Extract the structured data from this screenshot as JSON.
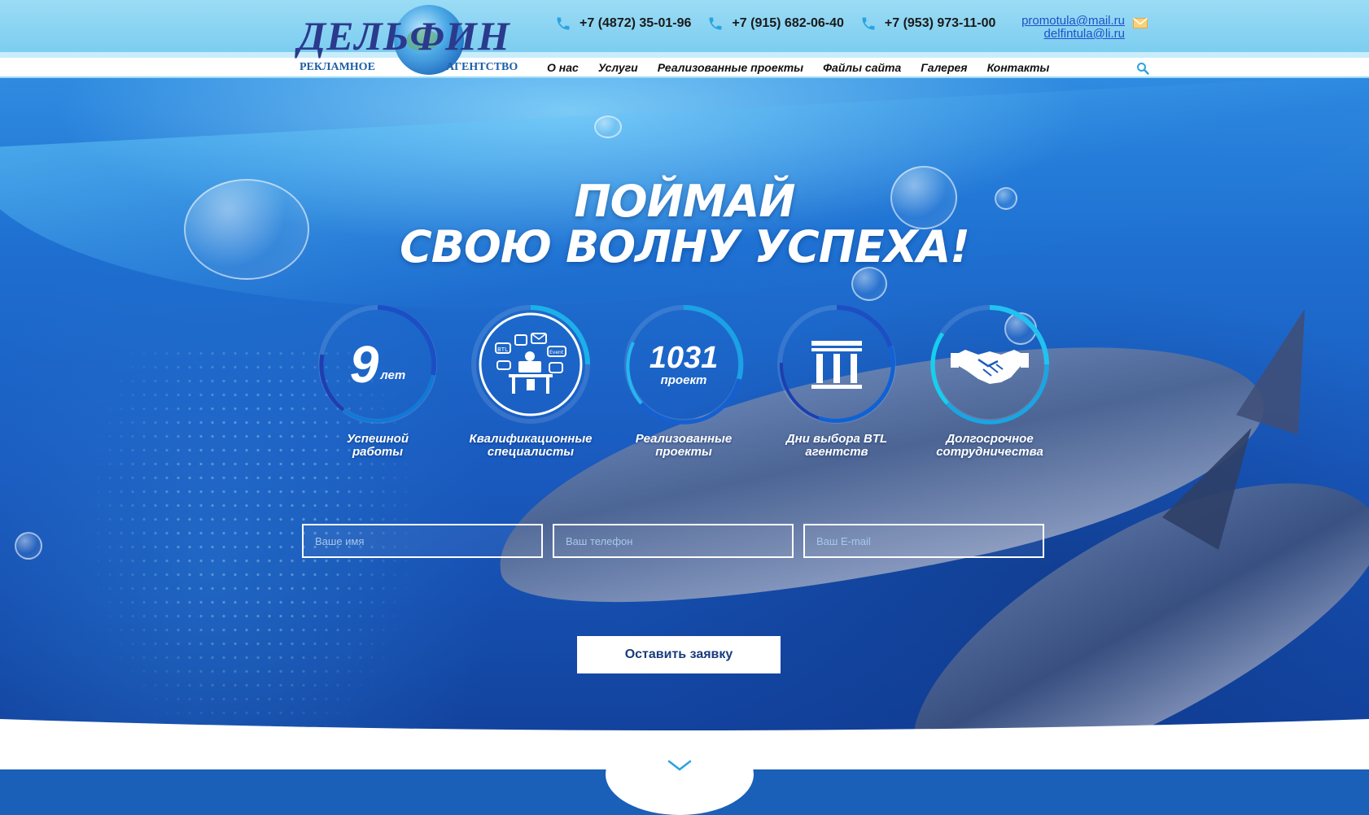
{
  "brand": {
    "logo_text": "ДЕЛЬФИН",
    "logo_sub_left": "РЕКЛАМНОЕ",
    "logo_sub_right": "АГЕНТСТВО"
  },
  "contacts": {
    "phones": [
      "+7 (4872) 35-01-96",
      "+7 (915) 682-06-40",
      "+7 (953) 973-11-00"
    ],
    "emails": [
      "promotula@mail.ru",
      "delfintula@li.ru"
    ]
  },
  "nav": {
    "items": [
      "О нас",
      "Услуги",
      "Реализованные проекты",
      "Файлы сайта",
      "Галерея",
      "Контакты"
    ]
  },
  "hero": {
    "headline_line1": "ПОЙМАЙ",
    "headline_line2": "СВОЮ ВОЛНУ УСПЕХА!"
  },
  "stats": [
    {
      "value": "9",
      "unit": "лет",
      "label_line1": "Успешной",
      "label_line2": "работы",
      "icon": "number"
    },
    {
      "value": "",
      "unit": "",
      "label_line1": "Квалификационные",
      "label_line2": "специалисты",
      "icon": "specialist-desk-icon"
    },
    {
      "value": "1031",
      "unit": "проект",
      "label_line1": "Реализованные",
      "label_line2": "проекты",
      "icon": "number"
    },
    {
      "value": "",
      "unit": "",
      "label_line1": "Дни выбора BTL",
      "label_line2": "агентств",
      "icon": "columns-building-icon"
    },
    {
      "value": "",
      "unit": "",
      "label_line1": "Долгосрочное",
      "label_line2": "сотрудничества",
      "icon": "handshake-icon"
    }
  ],
  "form": {
    "name_placeholder": "Ваше имя",
    "phone_placeholder": "Ваш телефон",
    "email_placeholder": "Ваш E-mail",
    "submit_label": "Оставить заявку"
  },
  "colors": {
    "accent_blue": "#1e6fd0",
    "header_top": "#8dd6f3",
    "brand_navy": "#2b3a8c",
    "link_blue": "#2050c8"
  }
}
